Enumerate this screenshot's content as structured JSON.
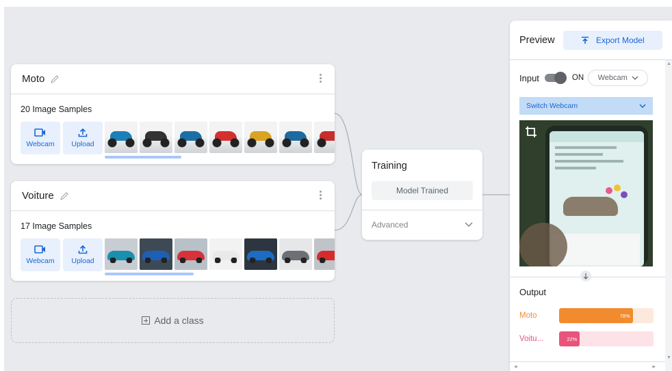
{
  "classes": [
    {
      "name": "Moto",
      "samples_label": "20 Image Samples",
      "webcam_label": "Webcam",
      "upload_label": "Upload"
    },
    {
      "name": "Voiture",
      "samples_label": "17 Image Samples",
      "webcam_label": "Webcam",
      "upload_label": "Upload"
    }
  ],
  "add_class_label": "Add a class",
  "training": {
    "title": "Training",
    "button_label": "Model Trained",
    "advanced_label": "Advanced"
  },
  "preview": {
    "title": "Preview",
    "export_label": "Export Model",
    "input_label": "Input",
    "toggle_state": "ON",
    "source_select": "Webcam",
    "switch_webcam_label": "Switch Webcam",
    "output_title": "Output",
    "outputs": [
      {
        "name": "Moto",
        "percent_label": "78%",
        "value": 78
      },
      {
        "name": "Voitu...",
        "percent_label": "22%",
        "value": 22
      }
    ]
  },
  "colors": {
    "accent": "#1967d2",
    "accent_light": "#e8f0fe",
    "moto_bar": "#f28b2e",
    "moto_track": "#fde9dc",
    "voiture_bar": "#e8547c",
    "voiture_track": "#fde2e8"
  },
  "icons": [
    "pencil-icon",
    "more-vert-icon",
    "webcam-icon",
    "upload-icon",
    "add-box-icon",
    "chevron-down-icon",
    "export-icon",
    "crop-icon",
    "arrow-down-icon"
  ]
}
